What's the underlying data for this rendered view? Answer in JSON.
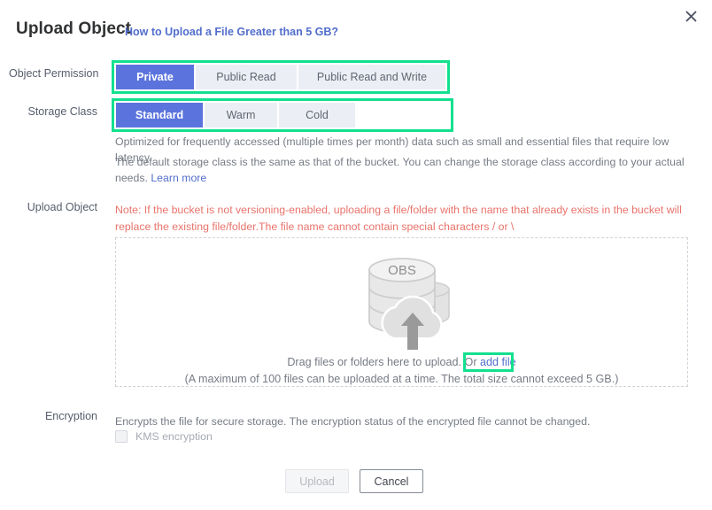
{
  "dialog": {
    "title": "Upload Object",
    "title_link": "How to Upload a File Greater than 5 GB?",
    "close_icon": "close-icon"
  },
  "colors": {
    "accent_selected": "#5b74dd",
    "link": "#526ecc",
    "annotation_highlight": "#12e08f",
    "warning_text": "#e8736b",
    "segment_bg": "#eceef5"
  },
  "object_permission": {
    "label": "Object Permission",
    "options": [
      {
        "label": "Private",
        "selected": true
      },
      {
        "label": "Public Read",
        "selected": false
      },
      {
        "label": "Public Read and Write",
        "selected": false
      }
    ]
  },
  "storage_class": {
    "label": "Storage Class",
    "options": [
      {
        "label": "Standard",
        "selected": true
      },
      {
        "label": "Warm",
        "selected": false
      },
      {
        "label": "Cold",
        "selected": false
      }
    ],
    "description": "Optimized for frequently accessed (multiple times per month) data such as small and essential files that require low latency.",
    "note_prefix": "The default storage class is the same as that of the bucket. You can change the storage class according to your actual needs. ",
    "note_link": "Learn more"
  },
  "upload_object": {
    "label": "Upload Object",
    "warning": "Note: If the bucket is not versioning-enabled, uploading a file/folder with the name that already exists in the bucket will replace the existing file/folder.The file name cannot contain special characters / or \\",
    "dropzone": {
      "icon_label": "OBS",
      "icon_name": "obs-cloud-upload-icon",
      "line1_prefix": "Drag files or folders here to upload. Or ",
      "line1_link": "add file",
      "line2": "(A maximum of 100 files can be uploaded at a time. The total size cannot exceed 5 GB.)"
    }
  },
  "encryption": {
    "label": "Encryption",
    "description": "Encrypts the file for secure storage. The encryption status of the encrypted file cannot be changed.",
    "checkbox_label": "KMS encryption",
    "checked": false,
    "disabled": true
  },
  "footer": {
    "upload_label": "Upload",
    "upload_disabled": true,
    "cancel_label": "Cancel"
  }
}
